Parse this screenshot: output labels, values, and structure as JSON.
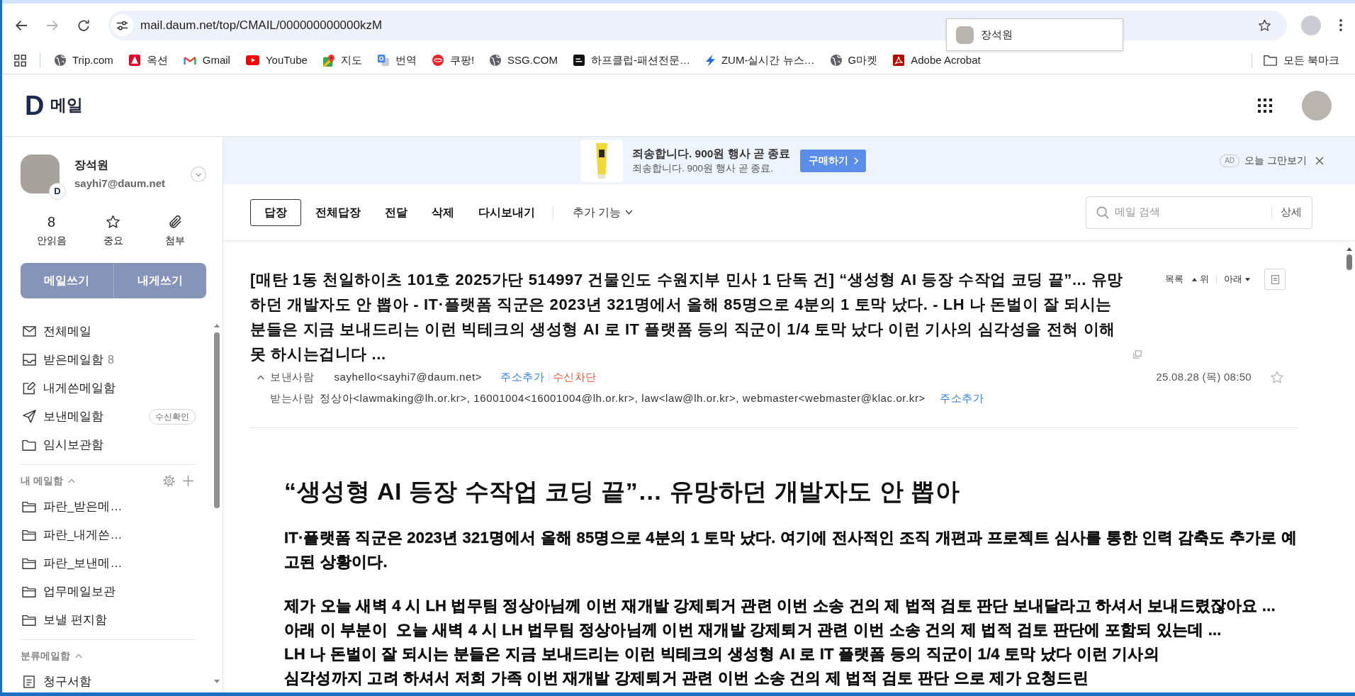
{
  "browser": {
    "nav_buttons": [
      {
        "kind": "back",
        "disabled": false
      },
      {
        "kind": "forward",
        "disabled": true
      },
      {
        "kind": "reload",
        "disabled": false
      }
    ],
    "url": "mail.daum.net/top/CMAIL/000000000000kzM",
    "profile_popup": {
      "name": "장석원"
    }
  },
  "bookmarks_bar": {
    "items": [
      {
        "kind": "globe",
        "label": "Trip.com"
      },
      {
        "kind": "auction",
        "label": "옥션"
      },
      {
        "kind": "gmail",
        "label": "Gmail"
      },
      {
        "kind": "youtube",
        "label": "YouTube"
      },
      {
        "kind": "maps",
        "label": "지도"
      },
      {
        "kind": "translate",
        "label": "번역"
      },
      {
        "kind": "coupang",
        "label": "쿠팡!"
      },
      {
        "kind": "globe",
        "label": "SSG.COM"
      },
      {
        "kind": "halfclub",
        "label": "하프클럽-패션전문…"
      },
      {
        "kind": "zum",
        "label": "ZUM-실시간 뉴스…"
      },
      {
        "kind": "globe",
        "label": "G마켓"
      },
      {
        "kind": "acrobat",
        "label": "Adobe Acrobat"
      }
    ],
    "all_bookmarks": "모든 북마크"
  },
  "header": {
    "logo_mark": "D",
    "title": "메일"
  },
  "sidebar": {
    "profile": {
      "name": "장석원",
      "email": "sayhi7@daum.net",
      "badge": "D"
    },
    "stats": [
      {
        "kind": "count",
        "value": "8",
        "label": "안읽음"
      },
      {
        "kind": "star",
        "label": "중요"
      },
      {
        "kind": "attachment",
        "label": "첨부"
      }
    ],
    "compose_buttons": [
      "메일쓰기",
      "내게쓰기"
    ],
    "folders": [
      {
        "kind": "all",
        "label": "전체메일"
      },
      {
        "kind": "inbox",
        "label": "받은메일함",
        "count": "8"
      },
      {
        "kind": "self",
        "label": "내게쓴메일함"
      },
      {
        "kind": "sent",
        "label": "보낸메일함",
        "tag": "수신확인"
      },
      {
        "kind": "draft",
        "label": "임시보관함"
      }
    ],
    "sections": [
      {
        "title": "내 메일함",
        "expanded": true,
        "tools": true,
        "folders": [
          {
            "kind": "folder",
            "label": "파란_받은메…"
          },
          {
            "kind": "folder",
            "label": "파란_내게쓴…"
          },
          {
            "kind": "folder",
            "label": "파란_보낸메…"
          },
          {
            "kind": "folder",
            "label": "업무메일보관"
          },
          {
            "kind": "folder",
            "label": "보낼 편지함"
          }
        ]
      },
      {
        "title": "분류메일함",
        "expanded": true,
        "tools": false,
        "folders": [
          {
            "kind": "bill",
            "label": "청구서함"
          }
        ]
      }
    ]
  },
  "ad": {
    "title": "죄송합니다. 900원 행사 곧 종료",
    "subtitle": "죄송합니다. 900원 행사 곧 종료.",
    "button": "구매하기",
    "badge": "AD",
    "dismiss": "오늘 그만보기"
  },
  "toolbar": {
    "buttons": [
      {
        "kind": "outlined",
        "label": "답장"
      },
      {
        "kind": "plain",
        "label": "전체답장"
      },
      {
        "kind": "plain",
        "label": "전달"
      },
      {
        "kind": "plain",
        "label": "삭제"
      },
      {
        "kind": "plain",
        "label": "다시보내기"
      }
    ],
    "more": "추가 기능",
    "search": {
      "placeholder": "메일 검색",
      "detail": "상세"
    }
  },
  "message": {
    "subject": "[매탄 1동 천일하이츠 101호 2025가단 514997 건물인도 수원지부 민사 1 단독 건] “생성형 AI 등장 수작업 코딩 끝”... 유망하던 개발자도 안 뽑아 - IT·플랫폼 직군은 2023년 321명에서 올해 85명으로 4분의 1 토막 났다. - LH 나 돈벌이 잘 되시는 분들은 지금 보내드리는 이런 빅테크의 생성형 AI 로 IT 플랫폼 등의 직군이 1/4 토막 났다 이런 기사의 심각성을 전혀 이해 못 하시는겁니다 ...",
    "nav": [
      {
        "kind": "list",
        "label": "목록"
      },
      {
        "kind": "up",
        "label": "위"
      },
      {
        "kind": "down",
        "label": "아래"
      }
    ],
    "sender": {
      "expanded": true,
      "label": "보낸사람",
      "value": "sayhello<sayhi7@daum.net>",
      "actions": [
        {
          "kind": "add",
          "label": "주소추가"
        },
        {
          "kind": "block",
          "label": "수신차단"
        }
      ]
    },
    "date": "25.08.28 (목) 08:50",
    "starred": false,
    "recipients": {
      "label": "받는사람",
      "value": "정상아<lawmaking@lh.or.kr>, 16001004<16001004@lh.or.kr>, law<law@lh.or.kr>, webmaster<webmaster@klac.or.kr>",
      "action": "주소추가"
    },
    "body": {
      "heading": "“생성형 AI 등장 수작업 코딩 끝”… 유망하던 개발자도 안 뽑아",
      "paragraphs": [
        {
          "lines": [
            "IT·플랫폼 직군은 2023년 321명에서 올해 85명으로 4분의 1 토막 났다. 여기에 전사적인 조직 개편과 프로젝트 심사를 통한 인력 감축도 추가로 예고된 상황이다."
          ]
        },
        {
          "lines": [
            "제가 오늘 새벽 4 시 LH 법무팀 정상아님께 이번 재개발 강제퇴거 관련 이번 소송 건의 제 법적 검토 판단 보내달라고 하셔서 보내드렸잖아요 ...",
            "아래 이 부분이  오늘 새벽 4 시 LH 법무팀 정상아님께 이번 재개발 강제퇴거 관련 이번 소송 건의 제 법적 검토 판단에 포함되 있는데 ...",
            "LH 나 돈벌이 잘 되시는 분들은 지금 보내드리는 이런 빅테크의 생성형 AI 로 IT 플랫폼 등의 직군이 1/4 토막 났다 이런 기사의",
            "심각성까지 고려 하셔서 저희 가족 이번 재개발 강제퇴거 관련 이번 소송 건의 제 법적 검토 판단 으로 제가 요청드린"
          ]
        }
      ]
    }
  }
}
